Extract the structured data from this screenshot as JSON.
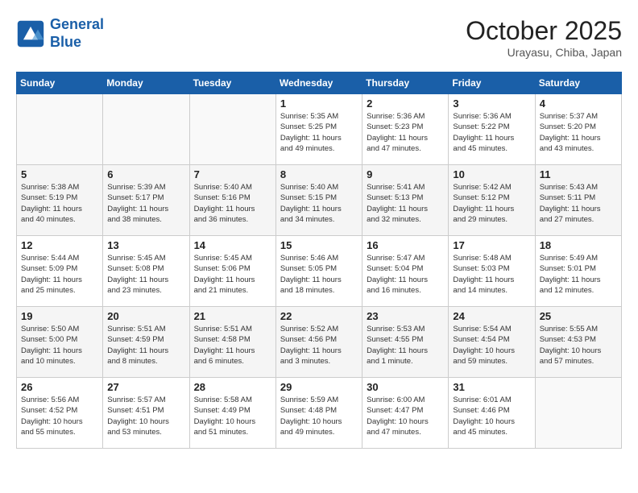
{
  "header": {
    "logo_line1": "General",
    "logo_line2": "Blue",
    "month": "October 2025",
    "location": "Urayasu, Chiba, Japan"
  },
  "weekdays": [
    "Sunday",
    "Monday",
    "Tuesday",
    "Wednesday",
    "Thursday",
    "Friday",
    "Saturday"
  ],
  "weeks": [
    [
      {
        "day": "",
        "info": ""
      },
      {
        "day": "",
        "info": ""
      },
      {
        "day": "",
        "info": ""
      },
      {
        "day": "1",
        "info": "Sunrise: 5:35 AM\nSunset: 5:25 PM\nDaylight: 11 hours\nand 49 minutes."
      },
      {
        "day": "2",
        "info": "Sunrise: 5:36 AM\nSunset: 5:23 PM\nDaylight: 11 hours\nand 47 minutes."
      },
      {
        "day": "3",
        "info": "Sunrise: 5:36 AM\nSunset: 5:22 PM\nDaylight: 11 hours\nand 45 minutes."
      },
      {
        "day": "4",
        "info": "Sunrise: 5:37 AM\nSunset: 5:20 PM\nDaylight: 11 hours\nand 43 minutes."
      }
    ],
    [
      {
        "day": "5",
        "info": "Sunrise: 5:38 AM\nSunset: 5:19 PM\nDaylight: 11 hours\nand 40 minutes."
      },
      {
        "day": "6",
        "info": "Sunrise: 5:39 AM\nSunset: 5:17 PM\nDaylight: 11 hours\nand 38 minutes."
      },
      {
        "day": "7",
        "info": "Sunrise: 5:40 AM\nSunset: 5:16 PM\nDaylight: 11 hours\nand 36 minutes."
      },
      {
        "day": "8",
        "info": "Sunrise: 5:40 AM\nSunset: 5:15 PM\nDaylight: 11 hours\nand 34 minutes."
      },
      {
        "day": "9",
        "info": "Sunrise: 5:41 AM\nSunset: 5:13 PM\nDaylight: 11 hours\nand 32 minutes."
      },
      {
        "day": "10",
        "info": "Sunrise: 5:42 AM\nSunset: 5:12 PM\nDaylight: 11 hours\nand 29 minutes."
      },
      {
        "day": "11",
        "info": "Sunrise: 5:43 AM\nSunset: 5:11 PM\nDaylight: 11 hours\nand 27 minutes."
      }
    ],
    [
      {
        "day": "12",
        "info": "Sunrise: 5:44 AM\nSunset: 5:09 PM\nDaylight: 11 hours\nand 25 minutes."
      },
      {
        "day": "13",
        "info": "Sunrise: 5:45 AM\nSunset: 5:08 PM\nDaylight: 11 hours\nand 23 minutes."
      },
      {
        "day": "14",
        "info": "Sunrise: 5:45 AM\nSunset: 5:06 PM\nDaylight: 11 hours\nand 21 minutes."
      },
      {
        "day": "15",
        "info": "Sunrise: 5:46 AM\nSunset: 5:05 PM\nDaylight: 11 hours\nand 18 minutes."
      },
      {
        "day": "16",
        "info": "Sunrise: 5:47 AM\nSunset: 5:04 PM\nDaylight: 11 hours\nand 16 minutes."
      },
      {
        "day": "17",
        "info": "Sunrise: 5:48 AM\nSunset: 5:03 PM\nDaylight: 11 hours\nand 14 minutes."
      },
      {
        "day": "18",
        "info": "Sunrise: 5:49 AM\nSunset: 5:01 PM\nDaylight: 11 hours\nand 12 minutes."
      }
    ],
    [
      {
        "day": "19",
        "info": "Sunrise: 5:50 AM\nSunset: 5:00 PM\nDaylight: 11 hours\nand 10 minutes."
      },
      {
        "day": "20",
        "info": "Sunrise: 5:51 AM\nSunset: 4:59 PM\nDaylight: 11 hours\nand 8 minutes."
      },
      {
        "day": "21",
        "info": "Sunrise: 5:51 AM\nSunset: 4:58 PM\nDaylight: 11 hours\nand 6 minutes."
      },
      {
        "day": "22",
        "info": "Sunrise: 5:52 AM\nSunset: 4:56 PM\nDaylight: 11 hours\nand 3 minutes."
      },
      {
        "day": "23",
        "info": "Sunrise: 5:53 AM\nSunset: 4:55 PM\nDaylight: 11 hours\nand 1 minute."
      },
      {
        "day": "24",
        "info": "Sunrise: 5:54 AM\nSunset: 4:54 PM\nDaylight: 10 hours\nand 59 minutes."
      },
      {
        "day": "25",
        "info": "Sunrise: 5:55 AM\nSunset: 4:53 PM\nDaylight: 10 hours\nand 57 minutes."
      }
    ],
    [
      {
        "day": "26",
        "info": "Sunrise: 5:56 AM\nSunset: 4:52 PM\nDaylight: 10 hours\nand 55 minutes."
      },
      {
        "day": "27",
        "info": "Sunrise: 5:57 AM\nSunset: 4:51 PM\nDaylight: 10 hours\nand 53 minutes."
      },
      {
        "day": "28",
        "info": "Sunrise: 5:58 AM\nSunset: 4:49 PM\nDaylight: 10 hours\nand 51 minutes."
      },
      {
        "day": "29",
        "info": "Sunrise: 5:59 AM\nSunset: 4:48 PM\nDaylight: 10 hours\nand 49 minutes."
      },
      {
        "day": "30",
        "info": "Sunrise: 6:00 AM\nSunset: 4:47 PM\nDaylight: 10 hours\nand 47 minutes."
      },
      {
        "day": "31",
        "info": "Sunrise: 6:01 AM\nSunset: 4:46 PM\nDaylight: 10 hours\nand 45 minutes."
      },
      {
        "day": "",
        "info": ""
      }
    ]
  ]
}
